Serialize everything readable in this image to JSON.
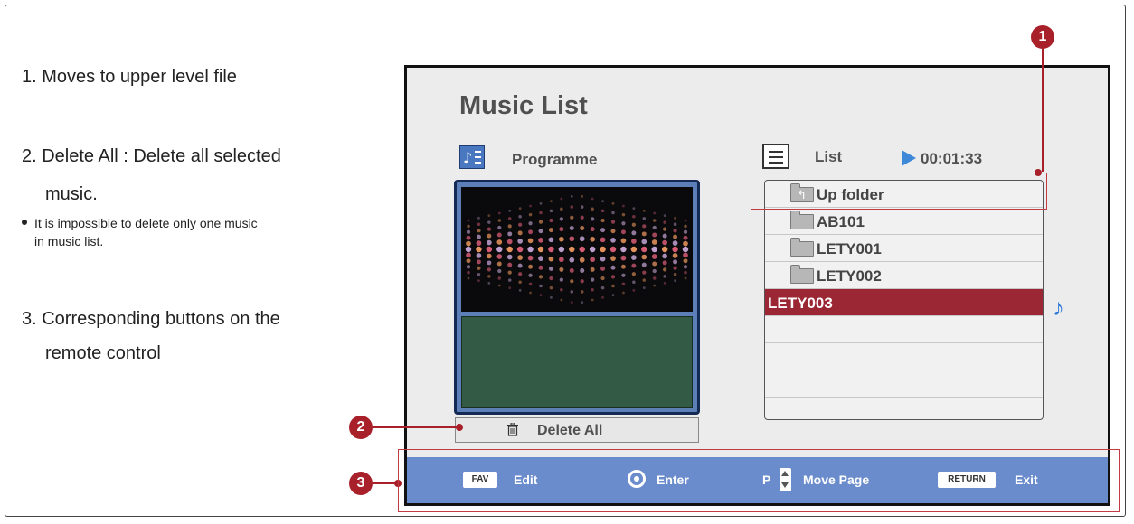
{
  "notes": {
    "item1": "1. Moves to upper level file",
    "item2_line1": "2. Delete All : Delete all selected",
    "item2_line2": "music.",
    "bullet_line1": "It is impossible to delete only one music",
    "bullet_line2": "in music list.",
    "item3_line1": "3. Corresponding buttons on the",
    "item3_line2": "remote control"
  },
  "screen": {
    "title": "Music List",
    "programme_label": "Programme",
    "list_label": "List",
    "time": "00:01:33",
    "delete_all_label": "Delete All"
  },
  "list": {
    "items": [
      {
        "label": "Up folder",
        "icon": "up-folder-icon",
        "selected": false
      },
      {
        "label": "AB101",
        "icon": "folder-icon",
        "selected": false
      },
      {
        "label": "LETY001",
        "icon": "folder-icon",
        "selected": false
      },
      {
        "label": "LETY002",
        "icon": "folder-icon",
        "selected": false
      },
      {
        "label": "LETY003",
        "icon": "music-note-icon",
        "selected": true
      }
    ]
  },
  "bottom_bar": {
    "fav_key": "FAV",
    "fav_action": "Edit",
    "enter_action": "Enter",
    "p_key": "P",
    "page_action": "Move Page",
    "return_key": "RETURN",
    "return_action": "Exit"
  },
  "callouts": {
    "c1": "1",
    "c2": "2",
    "c3": "3"
  },
  "colors": {
    "selected_row": "#9a2733",
    "bottom_bar": "#6b8ccc",
    "callout": "#a8202a",
    "play_indicator": "#3e88d8"
  }
}
